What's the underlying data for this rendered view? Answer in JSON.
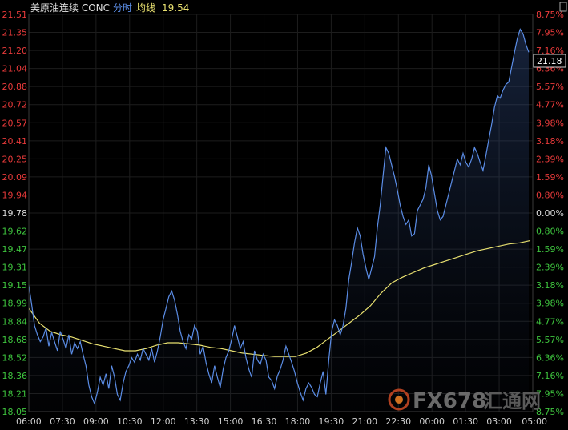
{
  "header": {
    "instrument": "美原油连续 CONC",
    "mode": "分时",
    "avg_label": "均线",
    "avg_value": "19.54"
  },
  "current_price_tag": "21.18",
  "watermark": {
    "text": "FX678",
    "suffix": "汇通网"
  },
  "colors": {
    "background": "#000000",
    "price_line": "#5b8de6",
    "avg_line": "#e8e070",
    "up": "#e83a3a",
    "down": "#3ec43e",
    "neutral": "#d8d8d8",
    "ref_line": "#e08060"
  },
  "chart_data": {
    "type": "line",
    "title": "",
    "xlabel": "",
    "ylabel": "",
    "base_price": 19.78,
    "ylim": [
      18.05,
      21.51
    ],
    "y_ticks": [
      "21.51",
      "21.35",
      "21.20",
      "21.04",
      "20.88",
      "20.72",
      "20.57",
      "20.41",
      "20.25",
      "20.09",
      "19.94",
      "19.78",
      "19.62",
      "19.47",
      "19.31",
      "19.15",
      "18.99",
      "18.84",
      "18.68",
      "18.52",
      "18.36",
      "18.21",
      "18.05"
    ],
    "pct_ticks": [
      "8.75%",
      "7.95%",
      "7.16%",
      "6.36%",
      "5.57%",
      "4.77%",
      "3.98%",
      "3.18%",
      "2.39%",
      "1.59%",
      "0.80%",
      "0.00%",
      "0.80%",
      "1.59%",
      "2.39%",
      "3.18%",
      "3.98%",
      "4.77%",
      "5.57%",
      "6.36%",
      "7.16%",
      "7.95%",
      "8.75%"
    ],
    "x_ticks": [
      "06:00",
      "07:30",
      "09:00",
      "10:30",
      "12:00",
      "13:30",
      "15:00",
      "16:30",
      "18:00",
      "19:30",
      "21:00",
      "22:30",
      "00:00",
      "01:30",
      "03:00",
      "05:00"
    ],
    "reference_price": 21.2,
    "series": [
      {
        "name": "分时",
        "values": [
          19.15,
          18.98,
          18.8,
          18.72,
          18.66,
          18.7,
          18.78,
          18.62,
          18.74,
          18.66,
          18.58,
          18.75,
          18.68,
          18.6,
          18.72,
          18.55,
          18.65,
          18.6,
          18.66,
          18.55,
          18.45,
          18.28,
          18.18,
          18.12,
          18.22,
          18.35,
          18.28,
          18.38,
          18.25,
          18.45,
          18.35,
          18.2,
          18.15,
          18.3,
          18.4,
          18.45,
          18.52,
          18.48,
          18.55,
          18.5,
          18.6,
          18.55,
          18.5,
          18.6,
          18.48,
          18.58,
          18.7,
          18.85,
          18.95,
          19.05,
          19.1,
          19.02,
          18.9,
          18.75,
          18.66,
          18.6,
          18.72,
          18.68,
          18.8,
          18.75,
          18.55,
          18.62,
          18.48,
          18.38,
          18.3,
          18.45,
          18.35,
          18.26,
          18.42,
          18.52,
          18.58,
          18.68,
          18.8,
          18.7,
          18.6,
          18.66,
          18.52,
          18.42,
          18.35,
          18.58,
          18.5,
          18.46,
          18.55,
          18.5,
          18.35,
          18.32,
          18.25,
          18.36,
          18.42,
          18.5,
          18.62,
          18.55,
          18.48,
          18.4,
          18.3,
          18.22,
          18.15,
          18.25,
          18.3,
          18.26,
          18.2,
          18.18,
          18.3,
          18.4,
          18.2,
          18.5,
          18.75,
          18.85,
          18.8,
          18.72,
          18.8,
          18.95,
          19.2,
          19.35,
          19.52,
          19.65,
          19.58,
          19.42,
          19.3,
          19.2,
          19.3,
          19.4,
          19.65,
          19.85,
          20.1,
          20.35,
          20.3,
          20.2,
          20.1,
          19.98,
          19.85,
          19.75,
          19.68,
          19.72,
          19.58,
          19.6,
          19.8,
          19.85,
          19.9,
          20.0,
          20.2,
          20.1,
          19.95,
          19.8,
          19.72,
          19.75,
          19.85,
          19.95,
          20.05,
          20.15,
          20.25,
          20.2,
          20.3,
          20.22,
          20.18,
          20.25,
          20.35,
          20.3,
          20.22,
          20.15,
          20.28,
          20.42,
          20.55,
          20.7,
          20.8,
          20.78,
          20.85,
          20.9,
          20.92,
          21.05,
          21.18,
          21.3,
          21.38,
          21.34,
          21.25,
          21.18
        ]
      },
      {
        "name": "均线",
        "values": [
          18.95,
          18.82,
          18.75,
          18.72,
          18.7,
          18.67,
          18.64,
          18.62,
          18.6,
          18.58,
          18.58,
          18.6,
          18.63,
          18.65,
          18.65,
          18.64,
          18.63,
          18.61,
          18.6,
          18.58,
          18.56,
          18.55,
          18.54,
          18.53,
          18.53,
          18.53,
          18.56,
          18.61,
          18.68,
          18.75,
          18.82,
          18.89,
          18.97,
          19.08,
          19.17,
          19.22,
          19.26,
          19.3,
          19.33,
          19.36,
          19.39,
          19.42,
          19.45,
          19.47,
          19.49,
          19.51,
          19.52,
          19.54
        ]
      }
    ],
    "grid": true,
    "legend": "none"
  }
}
